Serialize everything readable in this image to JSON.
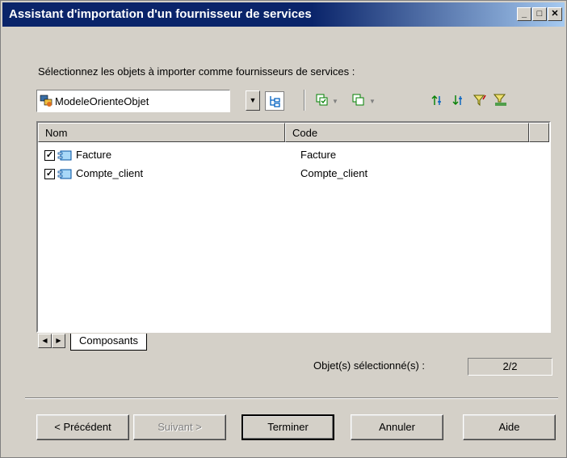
{
  "window": {
    "title": "Assistant d'importation d'un fournisseur de services",
    "controls": [
      "minimize",
      "maximize",
      "close"
    ]
  },
  "instruction": "Sélectionnez les objets à importer comme fournisseurs de services :",
  "model_selector": {
    "value": "ModeleOrienteObjet",
    "icon": "model-icon"
  },
  "toolbar": {
    "icons": [
      "hierarchy-icon",
      "select-all-icon",
      "deselect-all-icon",
      "move-up-icon",
      "move-down-icon",
      "filter-icon",
      "clear-filter-icon"
    ]
  },
  "list": {
    "columns": [
      "Nom",
      "Code"
    ],
    "rows": [
      {
        "checked": true,
        "name": "Facture",
        "code": "Facture"
      },
      {
        "checked": true,
        "name": "Compte_client",
        "code": "Compte_client"
      }
    ],
    "tab": "Composants"
  },
  "selection": {
    "label": "Objet(s) sélectionné(s) :",
    "value": "2/2"
  },
  "buttons": {
    "previous": "< Précédent",
    "next": "Suivant >",
    "finish": "Terminer",
    "cancel": "Annuler",
    "help": "Aide"
  },
  "colors": {
    "titlebar_start": "#0a246a",
    "titlebar_end": "#a6caf0",
    "dialog_bg": "#d4d0c8"
  }
}
